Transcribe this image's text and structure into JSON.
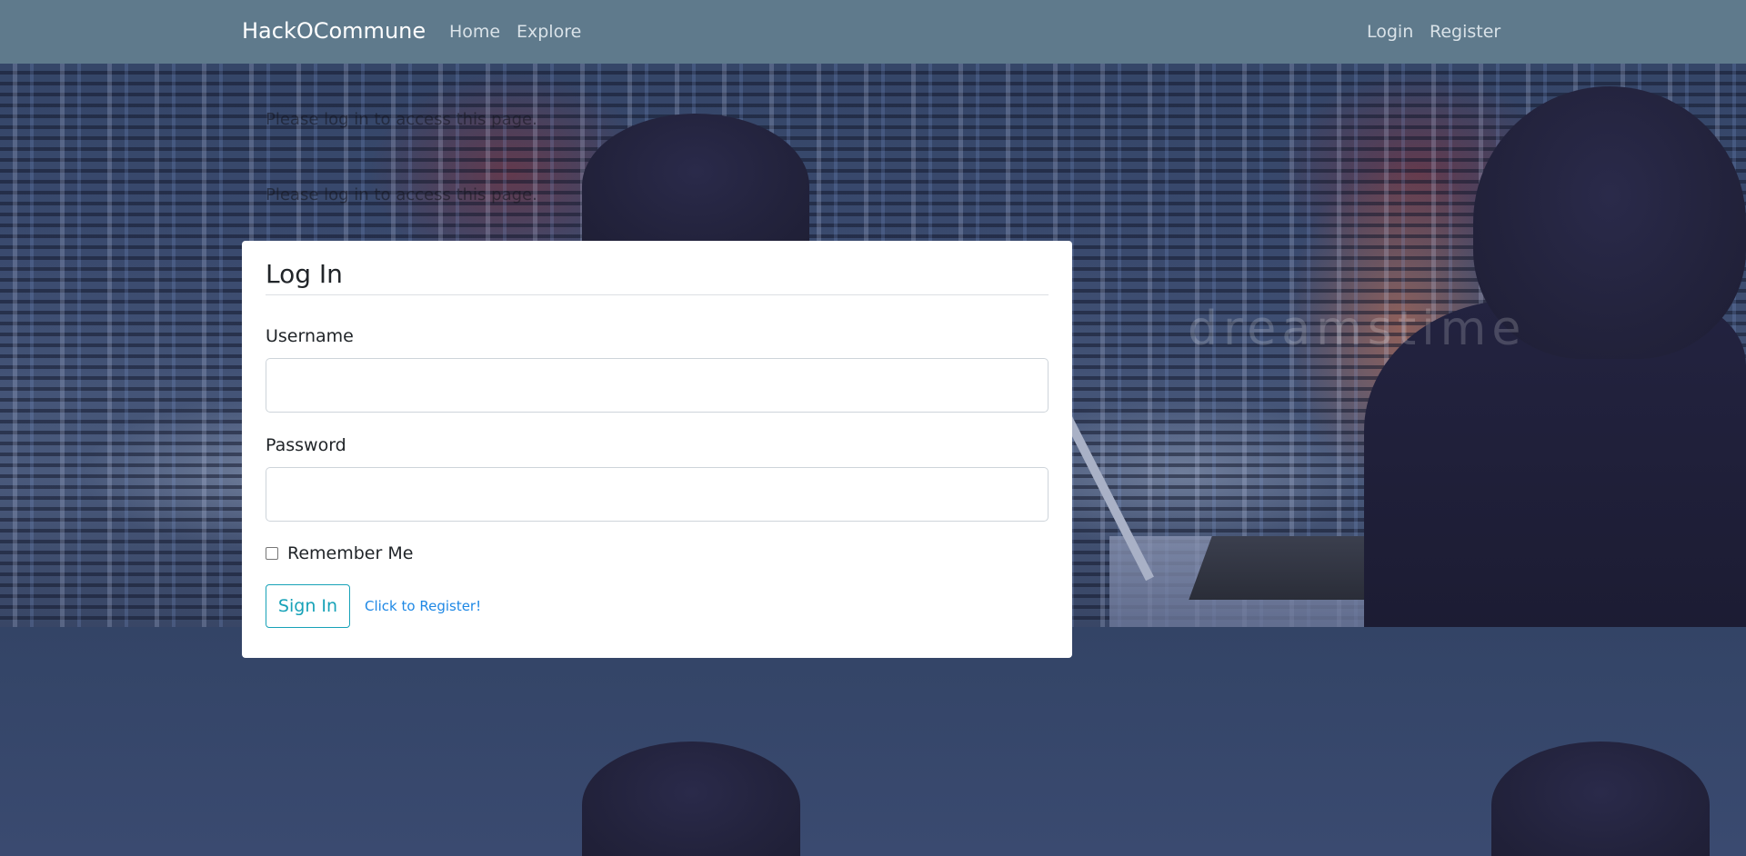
{
  "navbar": {
    "brand": "HackOCommune",
    "links": {
      "home": "Home",
      "explore": "Explore",
      "login": "Login",
      "register": "Register"
    },
    "background_color": "#5f7a8c"
  },
  "background": {
    "watermark": "dreamstime"
  },
  "flash_messages": [
    "Please log in to access this page.",
    "Please log in to access this page."
  ],
  "login_card": {
    "title": "Log In",
    "username_label": "Username",
    "username_value": "",
    "password_label": "Password",
    "password_value": "",
    "remember_label": "Remember Me",
    "remember_checked": false,
    "signin_label": "Sign In",
    "register_link": "Click to Register!",
    "accent_color": "#17a2b8",
    "link_color": "#1e88e5"
  }
}
